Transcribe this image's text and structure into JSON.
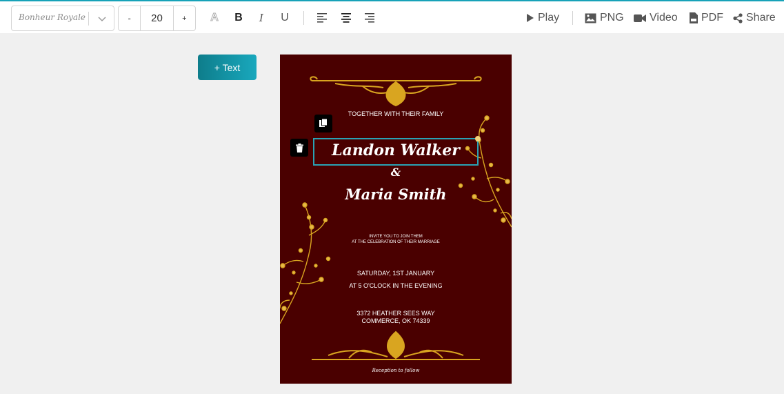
{
  "toolbar": {
    "font_family_value": "Bonheur Royale",
    "font_size_decrease_label": "-",
    "font_size_value": "20",
    "font_size_increase_label": "+",
    "text_stroke_label": "A",
    "bold_label": "B",
    "italic_label": "I",
    "underline_label": "U",
    "play_label": "Play",
    "png_label": "PNG",
    "video_label": "Video",
    "pdf_label": "PDF",
    "share_label": "Share"
  },
  "add_text_label": "+ Text",
  "card": {
    "intro": "TOGETHER WITH THEIR FAMILY",
    "groom": "Landon Walker",
    "ampersand": "&",
    "bride": "Maria Smith",
    "invite_line1": "INVITE YOU TO JOIN THEM",
    "invite_line2": "AT THE CELEBRATION OF THEIR MARRIAGE",
    "date": "SATURDAY, 1ST JANUARY",
    "time": "AT 5 O'CLOCK IN THE EVENING",
    "address_line1": "3372 HEATHER SEES WAY",
    "address_line2": "COMMERCE, OK 74339",
    "footer": "Reception to follow"
  },
  "colors": {
    "accent": "#17a2b8",
    "card_background": "#4a0000",
    "ornament_gold": "#d9a520",
    "selection_border": "#2aa3b5"
  },
  "icons": {
    "dropdown": "chevron-down-icon",
    "play": "play-icon",
    "png": "image-icon",
    "video": "video-camera-icon",
    "pdf": "pdf-file-icon",
    "share": "share-icon",
    "copy": "copy-icon",
    "delete": "trash-icon"
  }
}
